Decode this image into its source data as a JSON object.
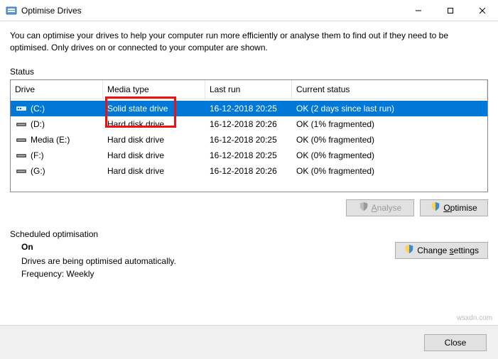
{
  "window": {
    "title": "Optimise Drives"
  },
  "description": "You can optimise your drives to help your computer run more efficiently or analyse them to find out if they need to be optimised. Only drives on or connected to your computer are shown.",
  "status_label": "Status",
  "columns": {
    "drive": "Drive",
    "media": "Media type",
    "last": "Last run",
    "status": "Current status"
  },
  "drives": [
    {
      "name": "(C:)",
      "media": "Solid state drive",
      "last": "16-12-2018 20:25",
      "status": "OK (2 days since last run)",
      "icon": "ssd",
      "selected": true
    },
    {
      "name": "(D:)",
      "media": "Hard disk drive",
      "last": "16-12-2018 20:26",
      "status": "OK (1% fragmented)",
      "icon": "hdd",
      "selected": false
    },
    {
      "name": "Media (E:)",
      "media": "Hard disk drive",
      "last": "16-12-2018 20:25",
      "status": "OK (0% fragmented)",
      "icon": "hdd",
      "selected": false
    },
    {
      "name": "(F:)",
      "media": "Hard disk drive",
      "last": "16-12-2018 20:25",
      "status": "OK (0% fragmented)",
      "icon": "hdd",
      "selected": false
    },
    {
      "name": "(G:)",
      "media": "Hard disk drive",
      "last": "16-12-2018 20:26",
      "status": "OK (0% fragmented)",
      "icon": "hdd",
      "selected": false
    }
  ],
  "buttons": {
    "analyse": "Analyse",
    "optimise": "Optimise",
    "change_settings": "Change settings",
    "close": "Close"
  },
  "scheduled": {
    "label": "Scheduled optimisation",
    "on": "On",
    "desc": "Drives are being optimised automatically.",
    "freq": "Frequency: Weekly"
  },
  "watermark": "wsxdn.com"
}
